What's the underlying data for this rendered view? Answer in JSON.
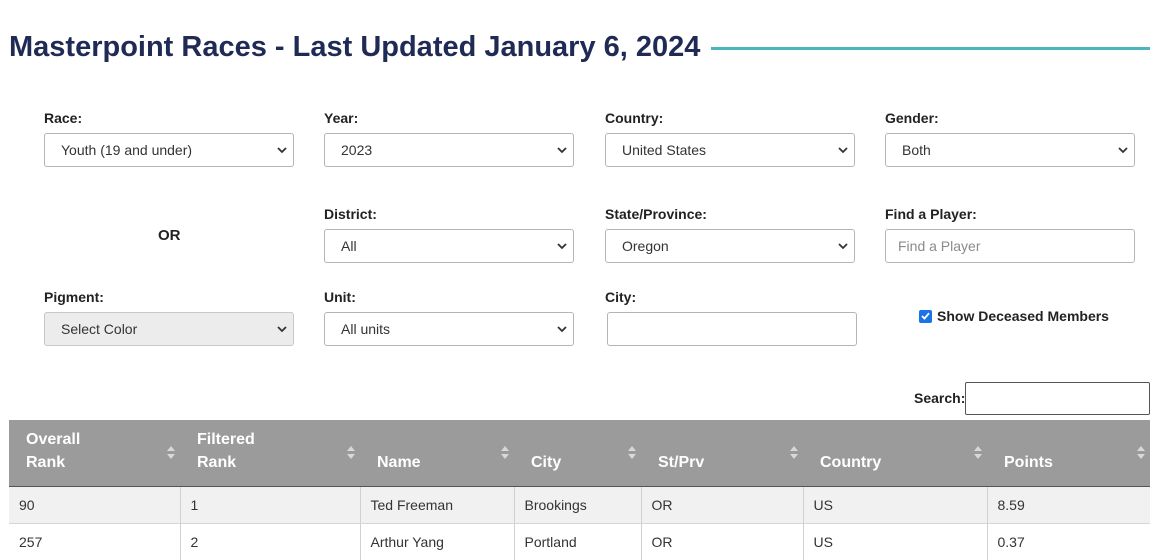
{
  "header": {
    "title": "Masterpoint Races - Last Updated January 6, 2024"
  },
  "colors": {
    "title": "#1f2a55",
    "accent_rule": "#4bb5bd",
    "table_header": "#9b9b9b",
    "checkbox": "#1a73e8"
  },
  "filters": {
    "race": {
      "label": "Race:",
      "value": "Youth (19 and under)"
    },
    "year": {
      "label": "Year:",
      "value": "2023"
    },
    "country": {
      "label": "Country:",
      "value": "United States"
    },
    "gender": {
      "label": "Gender:",
      "value": "Both"
    },
    "or_text": "OR",
    "district": {
      "label": "District:",
      "value": "All"
    },
    "state": {
      "label": "State/Province:",
      "value": "Oregon"
    },
    "find_player": {
      "label": "Find a Player:",
      "value": "",
      "placeholder": "Find a Player"
    },
    "pigment": {
      "label": "Pigment:",
      "value": "Select Color"
    },
    "unit": {
      "label": "Unit:",
      "value": "All units"
    },
    "city": {
      "label": "City:",
      "value": ""
    },
    "show_deceased": {
      "label": "Show Deceased Members",
      "checked": true
    }
  },
  "search": {
    "label": "Search:",
    "value": ""
  },
  "table": {
    "columns": [
      {
        "line1": "Overall",
        "line2": "Rank"
      },
      {
        "line1": "Filtered",
        "line2": "Rank"
      },
      {
        "line1": "",
        "line2": "Name"
      },
      {
        "line1": "",
        "line2": "City"
      },
      {
        "line1": "",
        "line2": "St/Prv"
      },
      {
        "line1": "",
        "line2": "Country"
      },
      {
        "line1": "",
        "line2": "Points"
      }
    ],
    "rows": [
      [
        "90",
        "1",
        "Ted Freeman",
        "Brookings",
        "OR",
        "US",
        "8.59"
      ],
      [
        "257",
        "2",
        "Arthur Yang",
        "Portland",
        "OR",
        "US",
        "0.37"
      ]
    ]
  }
}
